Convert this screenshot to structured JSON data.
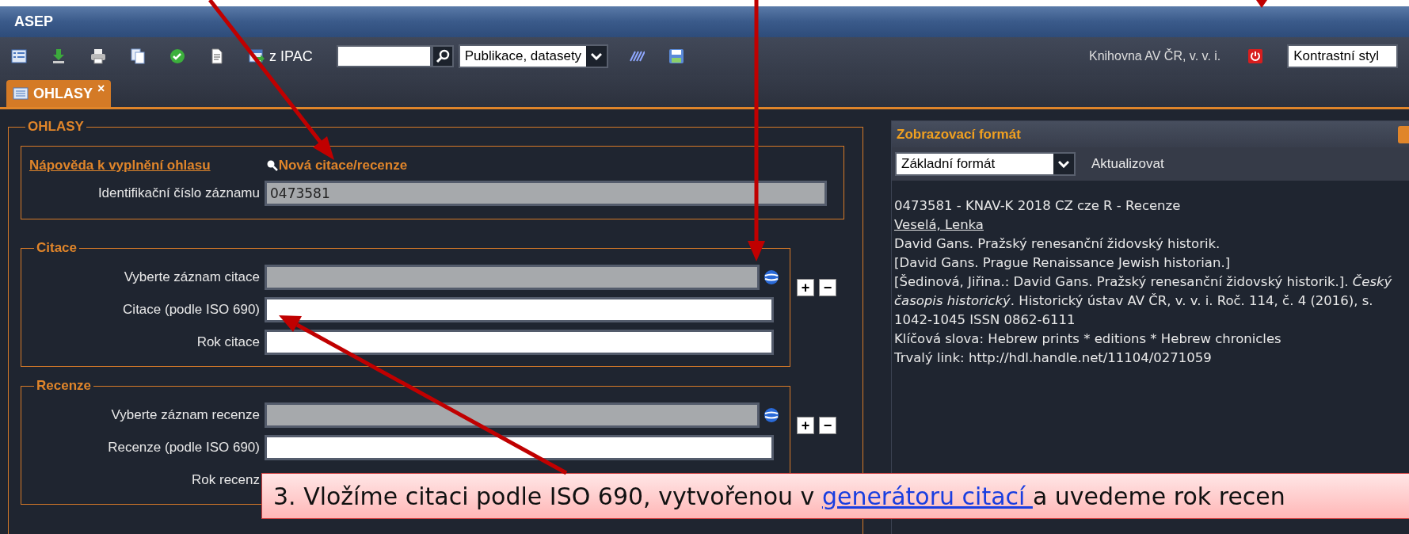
{
  "window": {
    "title": "ASEP"
  },
  "toolbar": {
    "import_button": "z IPAC",
    "scope_select": "Publikace, datasety",
    "organization": "Knihovna AV ČR, v. v. i.",
    "style_select": "Kontrastní styl"
  },
  "tabs": [
    {
      "label": "OHLASY",
      "selected": true,
      "close": "×"
    }
  ],
  "form": {
    "legend": "OHLASY",
    "help_link": "Nápověda k vyplnění ohlasu",
    "new_link": "Nová citace/recenze",
    "id_field": {
      "label": "Identifikační číslo záznamu",
      "value": "0473581"
    },
    "sections": [
      {
        "legend": "Citace",
        "buttons": [
          "+",
          "−"
        ],
        "fields": [
          {
            "label": "Vyberte záznam citace",
            "kind": "lookup"
          },
          {
            "label": "Citace (podle ISO 690)",
            "kind": "text"
          },
          {
            "label": "Rok citace",
            "kind": "text"
          }
        ]
      },
      {
        "legend": "Recenze",
        "buttons": [
          "+",
          "−"
        ],
        "fields": [
          {
            "label": "Vyberte záznam recenze",
            "kind": "lookup"
          },
          {
            "label": "Recenze (podle ISO 690)",
            "kind": "text"
          },
          {
            "label": "Rok recenz",
            "kind": "covered"
          }
        ]
      }
    ]
  },
  "panel": {
    "title": "Zobrazovací formát",
    "format_select": "Základní formát",
    "refresh": "Aktualizovat",
    "record": [
      {
        "kind": "text",
        "text": "0473581 - KNAV-K 2018 CZ cze R - Recenze"
      },
      {
        "kind": "link",
        "text": "Veselá, Lenka"
      },
      {
        "kind": "text",
        "text": "David Gans. Pražský renesanční židovský historik."
      },
      {
        "kind": "text",
        "text": "[David Gans. Prague Renaissance Jewish historian.]"
      },
      {
        "kind": "text",
        "text": "[Šedinová, Jiřina.: David Gans. Pražský renesanční židovský historik.]. *Český časopis historický*. Historický ústav AV ČR, v. v. i. Roč. 114, č. 4 (2016), s. 1042-1045 ISSN 0862-6111"
      },
      {
        "kind": "text",
        "text": "Klíčová slova: Hebrew prints * editions * Hebrew chronicles"
      },
      {
        "kind": "text",
        "text": "Trvalý link: http://hdl.handle.net/11104/0271059"
      }
    ]
  },
  "callout": {
    "text_before": "3. Vložíme citaci podle ISO 690, vytvořenou v ",
    "link": "generátoru citací ",
    "text_after": "a uvedeme rok recen"
  }
}
